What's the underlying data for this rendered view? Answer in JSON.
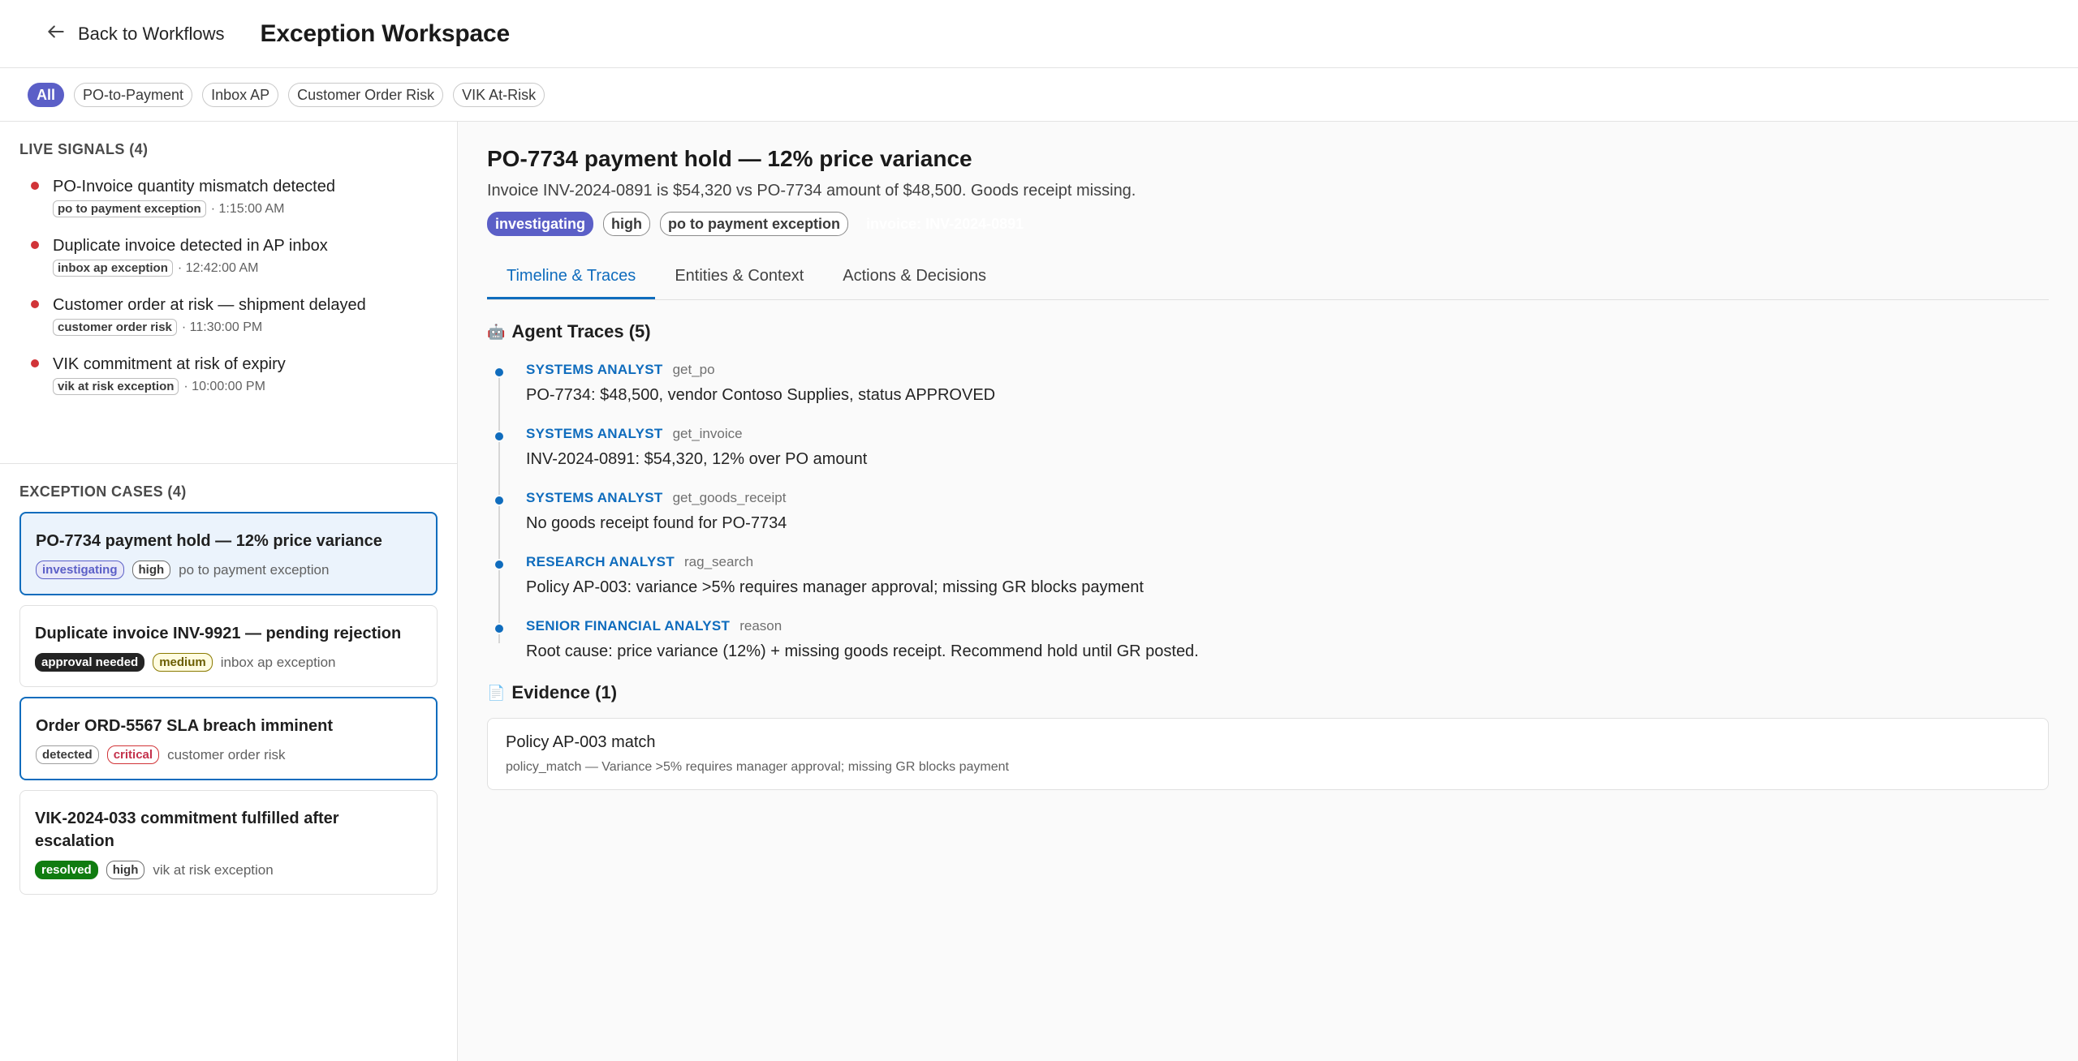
{
  "header": {
    "back_label": "Back to Workflows",
    "title": "Exception Workspace"
  },
  "filters": [
    {
      "label": "All",
      "active": true
    },
    {
      "label": "PO-to-Payment",
      "active": false
    },
    {
      "label": "Inbox AP",
      "active": false
    },
    {
      "label": "Customer Order Risk",
      "active": false
    },
    {
      "label": "VIK At-Risk",
      "active": false
    }
  ],
  "signals": {
    "title": "LIVE SIGNALS (4)",
    "items": [
      {
        "title": "PO-Invoice quantity mismatch detected",
        "tag": "po to payment exception",
        "time": "· 1:15:00 AM"
      },
      {
        "title": "Duplicate invoice detected in AP inbox",
        "tag": "inbox ap exception",
        "time": "· 12:42:00 AM"
      },
      {
        "title": "Customer order at risk — shipment delayed",
        "tag": "customer order risk",
        "time": "· 11:30:00 PM"
      },
      {
        "title": "VIK commitment at risk of expiry",
        "tag": "vik at risk exception",
        "time": "· 10:00:00 PM"
      }
    ]
  },
  "cases": {
    "title": "EXCEPTION CASES (4)",
    "items": [
      {
        "title": "PO-7734 payment hold — 12% price variance",
        "status": "investigating",
        "severity": "high",
        "type": "po to payment exception"
      },
      {
        "title": "Duplicate invoice INV-9921 — pending rejection",
        "status": "approval needed",
        "severity": "medium",
        "type": "inbox ap exception"
      },
      {
        "title": "Order ORD-5567 SLA breach imminent",
        "status": "detected",
        "severity": "critical",
        "type": "customer order risk"
      },
      {
        "title": "VIK-2024-033 commitment fulfilled after escalation",
        "status": "resolved",
        "severity": "high",
        "type": "vik at risk exception"
      }
    ]
  },
  "detail": {
    "title": "PO-7734 payment hold — 12% price variance",
    "subtitle": "Invoice INV-2024-0891 is $54,320 vs PO-7734 amount of $48,500. Goods receipt missing.",
    "tags": {
      "status": "investigating",
      "severity": "high",
      "type": "po to payment exception",
      "hidden": "invoice: INV-2024-0891"
    },
    "tabs": [
      "Timeline & Traces",
      "Entities & Context",
      "Actions & Decisions"
    ],
    "traces_title": "Agent Traces (5)",
    "traces": [
      {
        "agent": "SYSTEMS ANALYST",
        "tool": "get_po",
        "text": "PO-7734: $48,500, vendor Contoso Supplies, status APPROVED"
      },
      {
        "agent": "SYSTEMS ANALYST",
        "tool": "get_invoice",
        "text": "INV-2024-0891: $54,320, 12% over PO amount"
      },
      {
        "agent": "SYSTEMS ANALYST",
        "tool": "get_goods_receipt",
        "text": "No goods receipt found for PO-7734"
      },
      {
        "agent": "RESEARCH ANALYST",
        "tool": "rag_search",
        "text": "Policy AP-003: variance >5% requires manager approval; missing GR blocks payment"
      },
      {
        "agent": "SENIOR FINANCIAL ANALYST",
        "tool": "reason",
        "text": "Root cause: price variance (12%) + missing goods receipt. Recommend hold until GR posted."
      }
    ],
    "evidence_title": "Evidence (1)",
    "evidence": [
      {
        "title": "Policy AP-003 match",
        "desc": "policy_match — Variance >5% requires manager approval; missing GR blocks payment"
      }
    ]
  },
  "colors": {
    "accent": "#0f6cbd",
    "chip_active": "#5b5fc7",
    "signal_dot": "#d13438",
    "resolved": "#107c10"
  }
}
